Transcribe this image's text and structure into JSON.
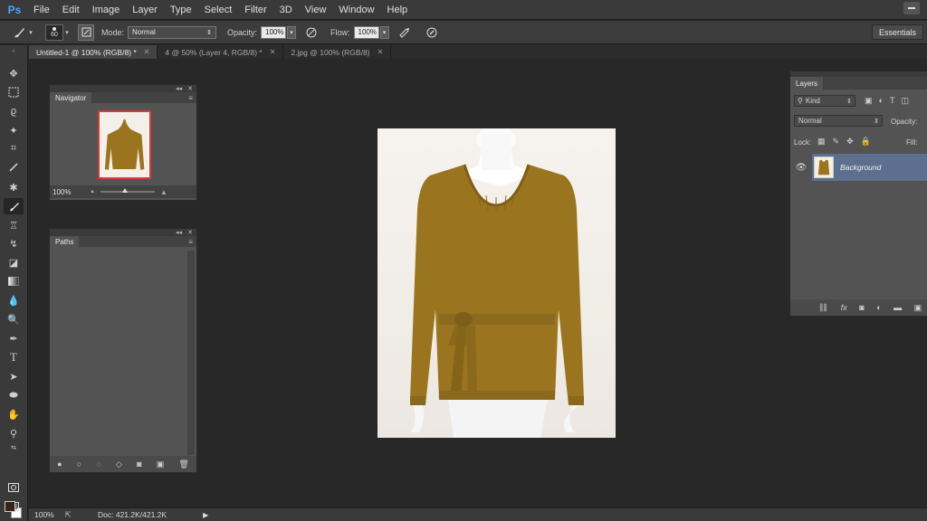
{
  "app": {
    "logo": "Ps"
  },
  "menu": [
    "File",
    "Edit",
    "Image",
    "Layer",
    "Type",
    "Select",
    "Filter",
    "3D",
    "View",
    "Window",
    "Help"
  ],
  "options": {
    "brush_size": "60",
    "mode_label": "Mode:",
    "mode_value": "Normal",
    "opacity_label": "Opacity:",
    "opacity_value": "100%",
    "flow_label": "Flow:",
    "flow_value": "100%",
    "workspace": "Essentials"
  },
  "tabs": [
    {
      "label": "Untitled-1 @ 100% (RGB/8) *",
      "active": true
    },
    {
      "label": "4 @ 50% (Layer 4, RGB/8) *",
      "active": false
    },
    {
      "label": "2.jpg @ 100% (RGB/8)",
      "active": false
    }
  ],
  "navigator": {
    "title": "Navigator",
    "zoom": "100%"
  },
  "paths": {
    "title": "Paths"
  },
  "layers": {
    "title": "Layers",
    "kind_label": "Kind",
    "blend_mode": "Normal",
    "opacity_label": "Opacity:",
    "lock_label": "Lock:",
    "fill_label": "Fill:",
    "layer_name": "Background"
  },
  "status": {
    "zoom": "100%",
    "doc": "Doc: 421.2K/421.2K"
  },
  "colors": {
    "foreground": "#3a2418",
    "background": "#ffffff",
    "sweater": "#9b7420"
  }
}
